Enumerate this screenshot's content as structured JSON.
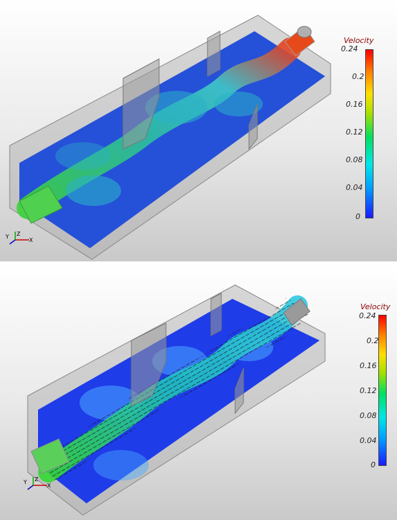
{
  "top_panel": {
    "colorbar": {
      "title": "Velocity",
      "ticks": [
        "0.24",
        "0.2",
        "0.16",
        "0.12",
        "0.08",
        "0.04",
        "0"
      ]
    },
    "axes_labels": [
      "Y",
      "Z",
      "X"
    ]
  },
  "bottom_panel": {
    "colorbar": {
      "title": "Velocity",
      "ticks": [
        "0.24",
        "0.2",
        "0.16",
        "0.12",
        "0.08",
        "0.04",
        "0"
      ]
    },
    "axes_labels": [
      "Y",
      "Z",
      "X"
    ]
  },
  "colors": {
    "low": "#1a1aff",
    "mid": "#00e060",
    "high": "#ff0000"
  }
}
